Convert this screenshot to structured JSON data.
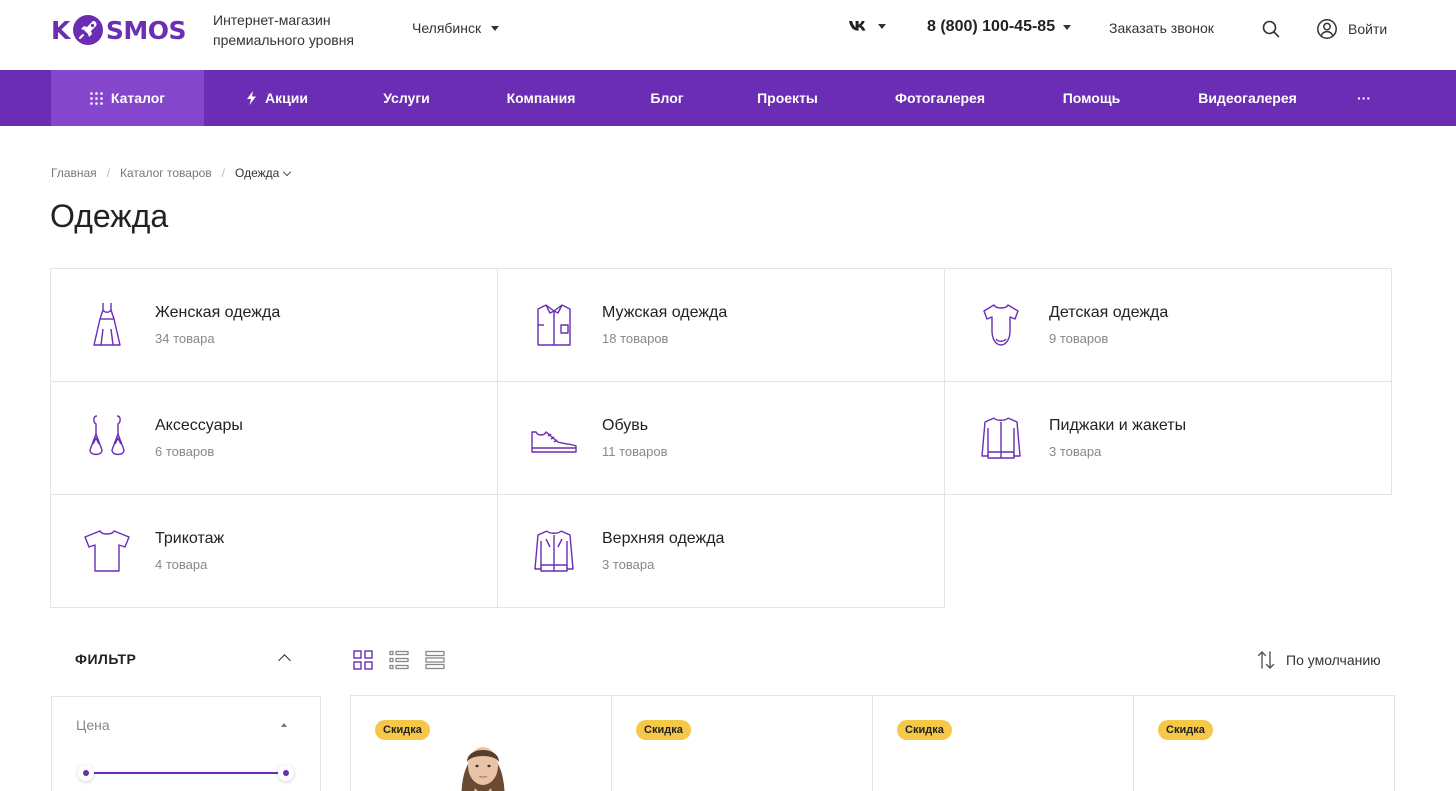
{
  "header": {
    "logo_left": "K",
    "logo_right": "SMOS",
    "tagline": "Интернет-магазин премиального уровня",
    "city": "Челябинск",
    "phone": "8 (800) 100-45-85",
    "callback": "Заказать звонок",
    "login": "Войти"
  },
  "nav": {
    "items": [
      {
        "label": "Каталог"
      },
      {
        "label": "Акции"
      },
      {
        "label": "Услуги"
      },
      {
        "label": "Компания"
      },
      {
        "label": "Блог"
      },
      {
        "label": "Проекты"
      },
      {
        "label": "Фотогалерея"
      },
      {
        "label": "Помощь"
      },
      {
        "label": "Видеогалерея"
      },
      {
        "label": "···"
      }
    ]
  },
  "breadcrumb": {
    "home": "Главная",
    "catalog": "Каталог товаров",
    "current": "Одежда"
  },
  "page": {
    "title": "Одежда"
  },
  "categories": [
    {
      "name": "Женская одежда",
      "count": "34 товара",
      "icon": "dress-icon"
    },
    {
      "name": "Мужская одежда",
      "count": "18 товаров",
      "icon": "shirt-icon"
    },
    {
      "name": "Детская одежда",
      "count": "9 товаров",
      "icon": "bodysuit-icon"
    },
    {
      "name": "Аксессуары",
      "count": "6 товаров",
      "icon": "earrings-icon"
    },
    {
      "name": "Обувь",
      "count": "11 товаров",
      "icon": "sneaker-icon"
    },
    {
      "name": "Пиджаки и жакеты",
      "count": "3 товара",
      "icon": "jacket-icon"
    },
    {
      "name": "Трикотаж",
      "count": "4 товара",
      "icon": "tshirt-icon"
    },
    {
      "name": "Верхняя одежда",
      "count": "3 товара",
      "icon": "coat-icon"
    }
  ],
  "filter": {
    "title": "ФИЛЬТР",
    "price_label": "Цена"
  },
  "sort": {
    "label": "По умолчанию"
  },
  "products": [
    {
      "badge": "Скидка"
    },
    {
      "badge": "Скидка"
    },
    {
      "badge": "Скидка"
    },
    {
      "badge": "Скидка"
    }
  ],
  "colors": {
    "brand": "#6a2db4",
    "nav_active": "#8446cb",
    "badge": "#f6c848"
  }
}
